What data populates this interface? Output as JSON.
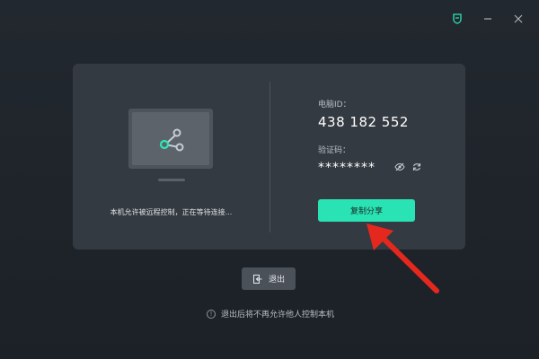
{
  "titlebar": {
    "icons": [
      "shield-icon",
      "minimize-icon",
      "close-icon"
    ]
  },
  "left_panel": {
    "status_text": "本机允许被远程控制，正在等待连接..."
  },
  "right_panel": {
    "id_label": "电脑ID：",
    "id_value": "438 182 552",
    "code_label": "验证码：",
    "code_value": "********",
    "copy_button_label": "复制分享"
  },
  "exit": {
    "button_label": "退出",
    "note": "退出后将不再允许他人控制本机"
  },
  "colors": {
    "accent": "#2ae3b4",
    "card": "#343a41",
    "background": "#1f242a",
    "arrow": "#e5281e"
  }
}
